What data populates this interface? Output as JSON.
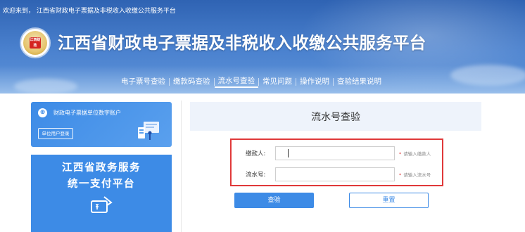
{
  "header": {
    "welcome_text": "欢迎来到， 江西省财政电子票据及非税收入收缴公共服务平台",
    "logo_label": "江西财政",
    "title": "江西省财政电子票据及非税收入收缴公共服务平台"
  },
  "nav": {
    "items": [
      {
        "label": "电子票号查验",
        "active": false
      },
      {
        "label": "缴款码查验",
        "active": false
      },
      {
        "label": "流水号查验",
        "active": true
      },
      {
        "label": "常见问题",
        "active": false
      },
      {
        "label": "操作说明",
        "active": false
      },
      {
        "label": "查验结果说明",
        "active": false
      }
    ]
  },
  "sidebar": {
    "account_card": {
      "icon": "user-circle-icon",
      "label": "财政电子票据单位数字账户",
      "login_button": "单位用户登录"
    },
    "pay_card": {
      "line1": "江西省政务服务",
      "line2": "统一支付平台",
      "icon": "payment-card-icon"
    }
  },
  "panel": {
    "title": "流水号查验",
    "form": {
      "payer": {
        "label": "缴款人:",
        "value": "",
        "hint": "请输入缴款人"
      },
      "serial": {
        "label": "流水号:",
        "value": "",
        "hint": "请输入流水号"
      }
    },
    "query_button": "查验",
    "reset_button": "重置"
  },
  "colors": {
    "header_blue": "#2f63b3",
    "accent_blue": "#3d8be6",
    "highlight_red": "#e0393a",
    "panel_title_bg": "#eef3fb"
  }
}
